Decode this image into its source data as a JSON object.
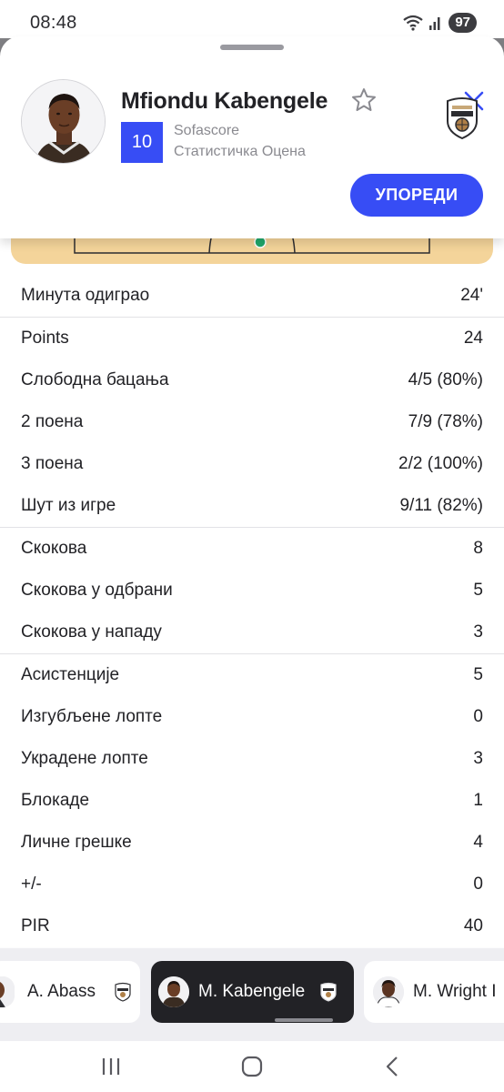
{
  "status_bar": {
    "time": "08:48",
    "battery": "97"
  },
  "player": {
    "name": "Mfiondu Kabengele",
    "rating": "10",
    "rating_source": "Sofascore",
    "rating_caption": "Статистичка Оцена",
    "compare_label": "УПОРЕДИ"
  },
  "stats": [
    {
      "label": "Минута одиграо",
      "value": "24'"
    },
    {
      "label": "Points",
      "value": "24"
    },
    {
      "label": "Слободна бацања",
      "value": "4/5 (80%)"
    },
    {
      "label": "2 поена",
      "value": "7/9 (78%)"
    },
    {
      "label": "3 поена",
      "value": "2/2 (100%)"
    },
    {
      "label": "Шут из игре",
      "value": "9/11 (82%)"
    },
    {
      "label": "Скокова",
      "value": "8"
    },
    {
      "label": "Скокова у одбрани",
      "value": "5"
    },
    {
      "label": "Скокова у нападу",
      "value": "3"
    },
    {
      "label": "Асистенције",
      "value": "5"
    },
    {
      "label": "Изгубљене лопте",
      "value": "0"
    },
    {
      "label": "Украдене лопте",
      "value": "3"
    },
    {
      "label": "Блокаде",
      "value": "1"
    },
    {
      "label": "Личне грешке",
      "value": "4"
    },
    {
      "label": "+/-",
      "value": "0"
    },
    {
      "label": "PIR",
      "value": "40"
    }
  ],
  "carousel": {
    "players": [
      {
        "name": "A. Abass",
        "active": false
      },
      {
        "name": "M. Kabengele",
        "active": true
      },
      {
        "name": "M. Wright I",
        "active": false
      }
    ]
  },
  "colors": {
    "accent": "#374df5",
    "court": "#f4d49a",
    "court_dot": "#20a86b",
    "dark_chip": "#222226"
  }
}
